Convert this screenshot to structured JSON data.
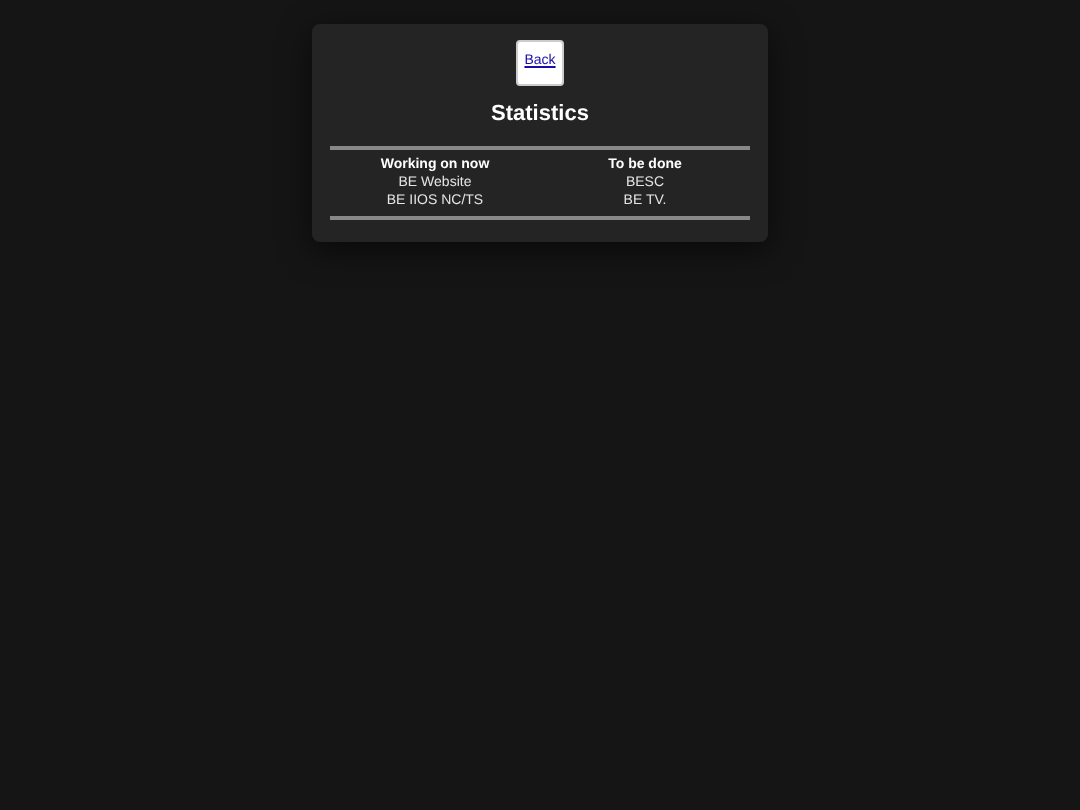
{
  "back_button": {
    "label": "Back"
  },
  "title": "Statistics",
  "table": {
    "columns": [
      "Working on now",
      "To be done"
    ],
    "rows": [
      [
        "BE Website",
        "BESC"
      ],
      [
        "BE IIOS NC/TS",
        "BE TV."
      ]
    ]
  }
}
